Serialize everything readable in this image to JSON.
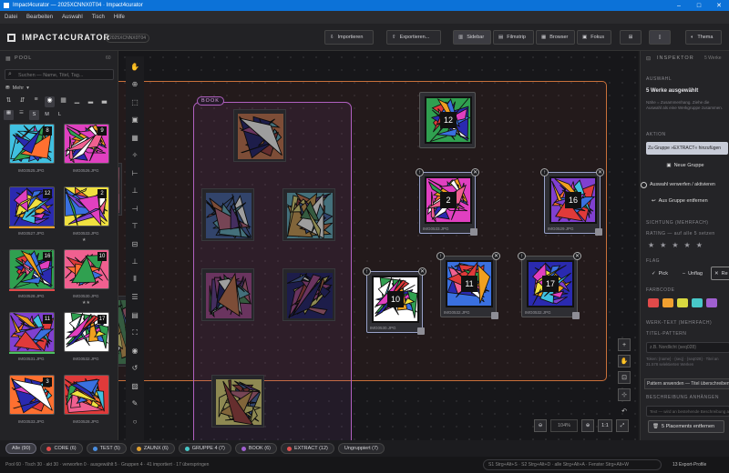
{
  "window": {
    "title": "Impact4curator — 2025XCNNX0T04 · Impact4curator"
  },
  "menu": [
    "Datei",
    "Bearbeiten",
    "Auswahl",
    "Tisch",
    "Hilfe"
  ],
  "header": {
    "app_name": "IMPACT4CURATOR",
    "project_id": "2025XCNNX0T04",
    "import_label": "Importieren",
    "export_label": "Exportieren...",
    "view_modes": [
      "Sidebar",
      "Filmstrip",
      "Browser",
      "Fokus"
    ],
    "theme_label": "Thema"
  },
  "pool": {
    "title": "POOL",
    "count": "60",
    "search_placeholder": "Suchen — Name, Titel, Tag...",
    "more_label": "Mehr",
    "size_options": [
      "S",
      "M",
      "L"
    ],
    "items": [
      {
        "name": "IMG0525.JPG",
        "num": "8"
      },
      {
        "name": "IMG0526.JPG",
        "num": "9"
      },
      {
        "name": "IMG0527.JPG",
        "num": "12"
      },
      {
        "name": "IMG0533.JPG",
        "num": "2"
      },
      {
        "name": "IMG0528.JPG",
        "num": "16"
      },
      {
        "name": "IMG0530.JPG",
        "num": "10"
      },
      {
        "name": "IMG0531.JPG",
        "num": "11"
      },
      {
        "name": "IMG0532.JPG",
        "num": "17"
      },
      {
        "name": "IMG0533.JPG",
        "num": "3"
      },
      {
        "name": "IMG0528.JPG",
        "num": ""
      }
    ]
  },
  "canvas": {
    "group_label": "BOOK",
    "cards": [
      {
        "num": "12",
        "name": ""
      },
      {
        "num": "2",
        "name": "IMG0533.JPG"
      },
      {
        "num": "16",
        "name": "IMG0529.JPG"
      },
      {
        "num": "11",
        "name": "IMG0532.JPG"
      },
      {
        "num": "17",
        "name": "IMG0532.JPG"
      },
      {
        "num": "10",
        "name": "IMG0530.JPG"
      }
    ],
    "zoom": "104%",
    "zoom_fit": "1:1"
  },
  "inspector": {
    "title": "INSPEKTOR",
    "count": "5 Werke",
    "auswahl_h": "AUSWAHL",
    "auswahl_t": "5 Werke ausgewählt",
    "auswahl_hint": "Nähe = Zusammenhang. Ziehe die Auswahl als eine Werkgruppe zusammen.",
    "aktion_h": "AKTION",
    "action_primary": "Zu Gruppe »EXTRACT« hinzufügen",
    "new_group": "Neue Gruppe",
    "discard": "Auswahl verwerfen / aktivieren",
    "remove_group": "Aus Gruppe entfernen",
    "sichtung_h": "SICHTUNG (MEHRFACH)",
    "rating_h": "RATING — auf alle 5 setzen",
    "flag_h": "FLAG",
    "flag_pick": "Pick",
    "flag_unflag": "Unflag",
    "flag_reject": "Re",
    "farbcode_h": "FARBCODE",
    "werktext_h": "WERK-TEXT (MEHRFACH)",
    "titel_h": "TITEL-PATTERN",
    "titel_placeholder": "z.B. Nordlicht {seq028}",
    "token_hint": "Token: {name} · {seq} · {seq028} · Titel an 31.578 selektierten Werken",
    "pattern_btn": "Pattern anwenden — Titel überschreiben",
    "beschreibung_h": "BESCHREIBUNG ANHÄNGEN",
    "beschreibung_hint": "Text — wird an bestehende Beschreibung angehängt",
    "remove_btn": "5 Placements entfernen",
    "colors": [
      "#e04a4a",
      "#f0a030",
      "#d8d840",
      "#48c8c8",
      "#a060d0"
    ]
  },
  "groups": [
    {
      "label": "Alle (90)",
      "color": ""
    },
    {
      "label": "CORE (6)",
      "color": "#e04a4a"
    },
    {
      "label": "TEST (5)",
      "color": "#4a8ee0"
    },
    {
      "label": "ZAUNX (6)",
      "color": "#e0a030"
    },
    {
      "label": "GRUPPE 4 (7)",
      "color": "#48c8c8"
    },
    {
      "label": "BOOK (6)",
      "color": "#a060d0"
    },
    {
      "label": "EXTRACT (12)",
      "color": "#e05050"
    },
    {
      "label": "Ungruppiert (7)",
      "color": ""
    }
  ],
  "status": {
    "left": "Pool 60 · Tisch 30 · akt 30 · verworfen 0 · ausgewählt 5 · Gruppen 4 · 41 importiert · 17 überspringen",
    "shortcuts": "S1 Strg+Alt+S · S2 Strg+Alt+D · alle Strg+Alt+A · Fenster Strg+Alt+W",
    "export": "13 Export-Profile"
  }
}
